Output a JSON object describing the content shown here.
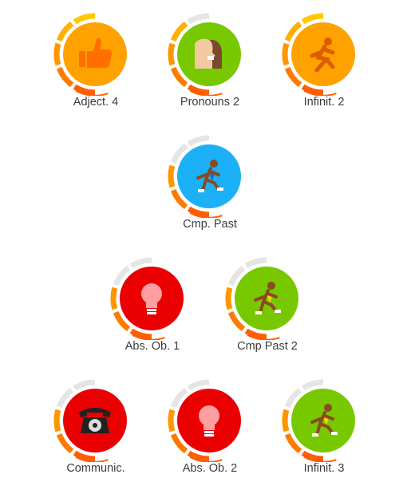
{
  "skills": [
    {
      "label": "Adject. 4",
      "icon": "thumbs-up-icon",
      "color": "#ffa200",
      "crown_level": 5
    },
    {
      "label": "Pronouns 2",
      "icon": "faces-icon",
      "color": "#78c800",
      "crown_level": 4
    },
    {
      "label": "Infinit. 2",
      "icon": "runner-icon",
      "color": "#ffa200",
      "crown_level": 5
    },
    {
      "label": "Cmp. Past",
      "icon": "runner-icon",
      "color": "#1cb0f6",
      "crown_level": 3
    },
    {
      "label": "Abs. Ob. 1",
      "icon": "lightbulb-icon",
      "color": "#ea0000",
      "crown_level": 3
    },
    {
      "label": "Cmp Past 2",
      "icon": "runner-icon",
      "color": "#78c800",
      "crown_level": 3
    },
    {
      "label": "Communic.",
      "icon": "telephone-icon",
      "color": "#ea0000",
      "crown_level": 3
    },
    {
      "label": "Abs. Ob. 2",
      "icon": "lightbulb-icon",
      "color": "#ea0000",
      "crown_level": 3
    },
    {
      "label": "Infinit. 3",
      "icon": "runner-icon",
      "color": "#78c800",
      "crown_level": 3
    }
  ]
}
